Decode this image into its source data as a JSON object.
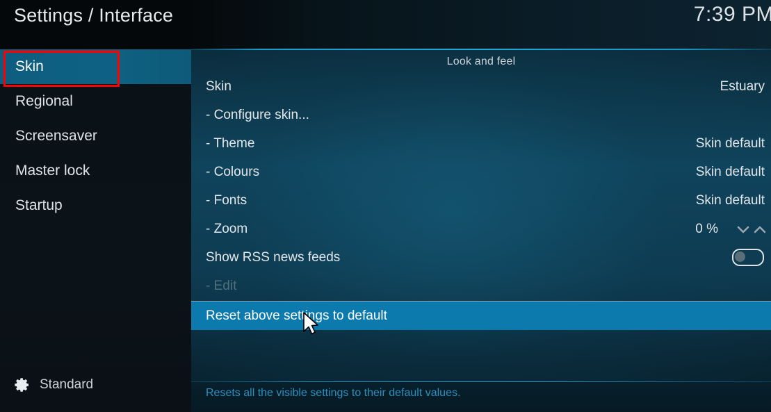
{
  "header": {
    "title": "Settings / Interface",
    "clock": "7:39 PM"
  },
  "sidebar": {
    "items": [
      {
        "label": "Skin",
        "selected": true
      },
      {
        "label": "Regional",
        "selected": false
      },
      {
        "label": "Screensaver",
        "selected": false
      },
      {
        "label": "Master lock",
        "selected": false
      },
      {
        "label": "Startup",
        "selected": false
      }
    ],
    "footer": {
      "icon": "gear-icon",
      "label": "Standard"
    }
  },
  "content": {
    "heading": "Look and feel",
    "rows": [
      {
        "label": "Skin",
        "value": "Estuary",
        "type": "value"
      },
      {
        "label": "- Configure skin...",
        "value": "",
        "type": "action"
      },
      {
        "label": "- Theme",
        "value": "Skin default",
        "type": "value"
      },
      {
        "label": "- Colours",
        "value": "Skin default",
        "type": "value"
      },
      {
        "label": "- Fonts",
        "value": "Skin default",
        "type": "value"
      },
      {
        "label": "- Zoom",
        "value": "0 %",
        "type": "spinner"
      },
      {
        "label": "Show RSS news feeds",
        "value": "off",
        "type": "toggle"
      },
      {
        "label": "- Edit",
        "value": "",
        "type": "disabled"
      },
      {
        "label": "Reset above settings to default",
        "value": "",
        "type": "selected"
      }
    ]
  },
  "footer": {
    "description": "Resets all the visible settings to their default values."
  },
  "annotation": {
    "target": "Skin",
    "color": "#ff0000"
  },
  "colors": {
    "selection_blue": "#0c7aad",
    "sidebar_selection": "#0f6183",
    "accent_divider": "#22a6d6",
    "footer_text": "#2d8fbd",
    "annotation_red": "#ff0000"
  }
}
